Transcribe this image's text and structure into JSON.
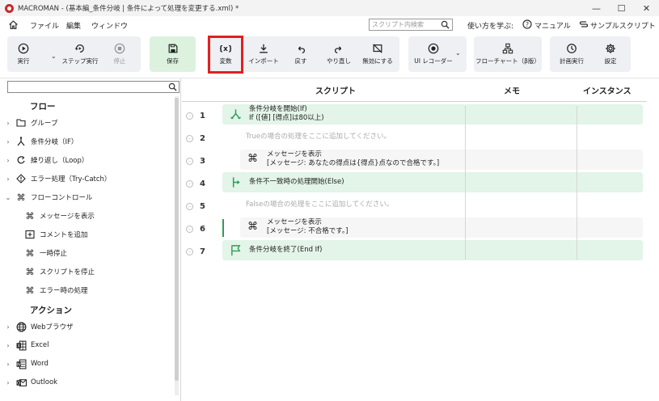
{
  "window": {
    "title": "MACROMAN - (基本編_条件分岐 | 条件によって処理を変更する.xml) *",
    "controls": [
      "—",
      "☐",
      "✕"
    ]
  },
  "menu": {
    "items": [
      "ファイル",
      "編集",
      "ウィンドウ"
    ],
    "search_placeholder": "スクリプト内検索",
    "help": {
      "learn": "使い方を学ぶ:",
      "manual": "マニュアル",
      "samples": "サンプルスクリプト"
    }
  },
  "toolbar": {
    "run": "実行",
    "step": "ステップ実行",
    "stop": "停止",
    "save": "保存",
    "variable": "変数",
    "import": "インポート",
    "undo": "戻す",
    "redo": "やり直し",
    "disable": "無効にする",
    "ui_recorder": "UI レコーダー",
    "flowchart": "フローチャート（β版）",
    "schedule": "計画実行",
    "settings": "設定"
  },
  "sidebar": {
    "flow_title": "フロー",
    "flow_items": [
      {
        "label": "グループ",
        "icon": "group-icon",
        "expandable": true
      },
      {
        "label": "条件分岐（IF）",
        "icon": "branch-icon",
        "expandable": true
      },
      {
        "label": "繰り返し（Loop）",
        "icon": "loop-icon",
        "expandable": true
      },
      {
        "label": "エラー処理（Try-Catch）",
        "icon": "error-icon",
        "expandable": true
      },
      {
        "label": "フローコントロール",
        "icon": "command-icon",
        "expandable": true,
        "expanded": true
      }
    ],
    "flow_control_children": [
      {
        "label": "メッセージを表示",
        "icon": "command-icon"
      },
      {
        "label": "コメントを追加",
        "icon": "comment-icon"
      },
      {
        "label": "一時停止",
        "icon": "command-icon"
      },
      {
        "label": "スクリプトを停止",
        "icon": "command-icon"
      },
      {
        "label": "エラー時の処理",
        "icon": "command-icon"
      }
    ],
    "action_title": "アクション",
    "action_items": [
      {
        "label": "Webブラウザ",
        "icon": "globe-icon"
      },
      {
        "label": "Excel",
        "icon": "excel-icon"
      },
      {
        "label": "Word",
        "icon": "word-icon"
      },
      {
        "label": "Outlook",
        "icon": "outlook-icon"
      }
    ]
  },
  "script": {
    "headers": {
      "script": "スクリプト",
      "memo": "メモ",
      "instance": "インスタンス"
    },
    "rows": [
      {
        "num": "1",
        "line1": "条件分岐を開始(If)",
        "line2": "If ([値] [得点]は80以上)",
        "icon": "if-branch-icon",
        "style": "green"
      },
      {
        "num": "2",
        "line1": "Trueの場合の処理をここに追加してください。",
        "style": "placeholder"
      },
      {
        "num": "3",
        "line1": "メッセージを表示",
        "line2": "[メッセージ: あなたの得点は{得点}点なので合格です。]",
        "icon": "command-icon",
        "style": "grey"
      },
      {
        "num": "4",
        "line1": "条件不一致時の処理開始(Else)",
        "icon": "else-branch-icon",
        "style": "green"
      },
      {
        "num": "5",
        "line1": "Falseの場合の処理をここに追加してください。",
        "style": "placeholder"
      },
      {
        "num": "6",
        "line1": "メッセージを表示",
        "line2": "[メッセージ: 不合格です。]",
        "icon": "command-icon",
        "style": "grey",
        "active": true
      },
      {
        "num": "7",
        "line1": "条件分岐を終了(End If)",
        "icon": "flag-icon",
        "style": "green"
      }
    ]
  },
  "colors": {
    "accent_green": "#2e9e55",
    "row_green": "#e3f4e8",
    "highlight_red": "#e02020",
    "logo_red": "#c62828"
  }
}
